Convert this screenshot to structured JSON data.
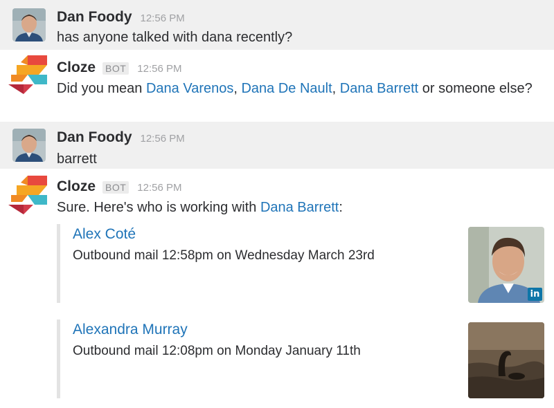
{
  "messages": [
    {
      "author": "Dan Foody",
      "time": "12:56 PM",
      "text": "has anyone talked with dana recently?"
    },
    {
      "author": "Cloze",
      "bot_label": "BOT",
      "time": "12:56 PM",
      "pre": "Did you mean ",
      "link1": "Dana Varenos",
      "sep1": ", ",
      "link2": "Dana De Nault",
      "sep2": ", ",
      "link3": "Dana Barrett",
      "post": " or someone else?"
    },
    {
      "author": "Dan Foody",
      "time": "12:56 PM",
      "text": "barrett"
    },
    {
      "author": "Cloze",
      "bot_label": "BOT",
      "time": "12:56 PM",
      "pre": "Sure. Here's who is working with ",
      "link": "Dana Barrett",
      "post": ":",
      "attachments": [
        {
          "name": "Alex Coté",
          "detail": "Outbound mail 12:58pm on Wednesday March 23rd",
          "badge": "in"
        },
        {
          "name": "Alexandra Murray",
          "detail": "Outbound mail 12:08pm on Monday January 11th"
        }
      ]
    }
  ],
  "colors": {
    "link": "#1f74b8",
    "highlight_bg": "#f0f0f0",
    "attachment_bar": "#e3e3e3",
    "linkedin": "#0e76a8"
  },
  "icons": {
    "user_avatar": "user-avatar",
    "bot_avatar": "cloze-logo-icon",
    "linkedin": "linkedin-icon"
  }
}
